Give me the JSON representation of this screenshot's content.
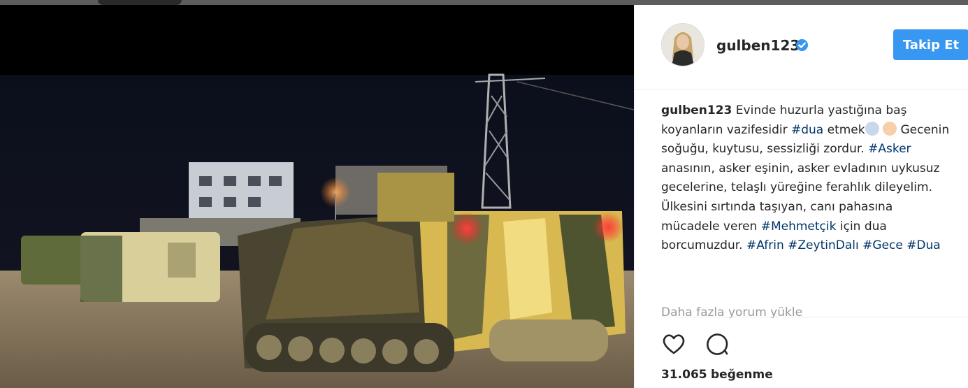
{
  "post": {
    "username": "gulben123",
    "follow_label": "Takip Et",
    "caption": {
      "username": "gulben123",
      "line1": "Evinde huzurla yastığına baş koyanların vazifesidir",
      "tag_dua": "#dua",
      "line2": "etmek",
      "line3": "Gecenin soğuğu, kuytusu, sessizliği zordur.",
      "tag_asker": "#Asker",
      "line4": "anasının, asker eşinin, asker evladının uykusuz gecelerine, telaşlı yüreğine ferahlık dileyelim. Ülkesini sırtında taşıyan, canı pahasına mücadele veren",
      "tag_mehmetcik": "#Mehmetçik",
      "line5": "için dua borcumuzdur.",
      "tag_afrin": "#Afrin",
      "tag_zeytindali": "#ZeytinDalı",
      "tag_gece": "#Gece",
      "tag_dua2": "#Dua"
    },
    "load_more": "Daha fazla yorum yükle",
    "likes_count": "31.065",
    "likes_word": "beğenme"
  },
  "icons": {
    "verified": "verified-badge-icon",
    "like": "heart-icon",
    "comment": "comment-bubble-icon"
  },
  "colors": {
    "accent": "#3897f0",
    "hashtag": "#003569",
    "muted": "#999999"
  }
}
